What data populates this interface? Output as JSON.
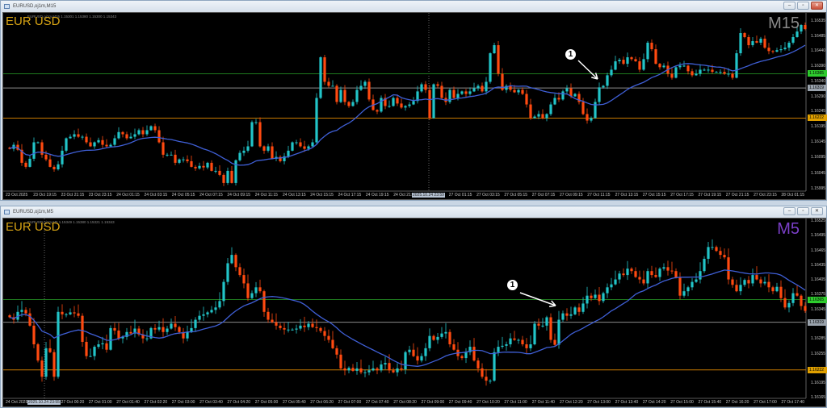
{
  "colors": {
    "bull": "#22c4c8",
    "bear": "#ff4a10",
    "ma": "#3f5fd6",
    "green_line": "#1f7a1f",
    "gray_line": "#8a8a8a",
    "orange_line": "#c87a00",
    "symbol": "#d9a514",
    "m15": "#8a8a8a",
    "m5": "#7b3fc8"
  },
  "windows": [
    {
      "title": "EURUSD,oj1m,M15",
      "symbol_label": "EUR USD",
      "ohlc_text": "EURUSD,oj1m,M15 1.15301 1.15380 1.15300 1.15343",
      "timeframe_label": "M15",
      "annotation": "1",
      "buttons": {
        "minimize": "–",
        "maximize": "▫",
        "close": "✕"
      },
      "price_badges": [
        {
          "value": "1.16365",
          "color": "#2ecc2e"
        },
        {
          "value": "1.16319",
          "color": "#9aa3ad"
        },
        {
          "value": "1.16222",
          "color": "#e0a000"
        }
      ],
      "time_highlight": "2025.10.24 23:59",
      "time_labels": [
        "23 Oct 2025",
        "23 Oct 19:15",
        "23 Oct 21:15",
        "23 Oct 23:15",
        "24 Oct 01:15",
        "24 Oct 03:15",
        "24 Oct 05:15",
        "24 Oct 07:15",
        "24 Oct 09:15",
        "24 Oct 11:15",
        "24 Oct 13:15",
        "24 Oct 15:15",
        "24 Oct 17:15",
        "24 Oct 19:15",
        "24 Oct 21:15",
        "",
        "27 Oct 01:15",
        "27 Oct 03:15",
        "27 Oct 05:15",
        "27 Oct 07:15",
        "27 Oct 09:15",
        "27 Oct 11:15",
        "27 Oct 13:15",
        "27 Oct 15:15",
        "27 Oct 17:15",
        "27 Oct 19:15",
        "27 Oct 21:15",
        "27 Oct 23:15",
        "28 Oct 01:15"
      ]
    },
    {
      "title": "EURUSD,oj1m,M5",
      "symbol_label": "EUR USD",
      "ohlc_text": "EURUSD,oj1m,M5 1.15349 1.15380 1.15321 1.15343",
      "timeframe_label": "M5",
      "annotation": "1",
      "buttons": {
        "minimize": "–",
        "maximize": "▫",
        "close": "✕"
      },
      "price_badges": [
        {
          "value": "1.16365",
          "color": "#2ecc2e"
        },
        {
          "value": "1.16319",
          "color": "#9aa3ad"
        },
        {
          "value": "1.16222",
          "color": "#e0a000"
        }
      ],
      "time_highlight": "2025.10.24 23:55",
      "time_labels": [
        "24 Oct 2025",
        "",
        "27 Oct 00:20",
        "27 Oct 01:00",
        "27 Oct 01:40",
        "27 Oct 02:20",
        "27 Oct 03:00",
        "27 Oct 03:40",
        "27 Oct 04:20",
        "27 Oct 05:00",
        "27 Oct 05:40",
        "27 Oct 06:20",
        "27 Oct 07:00",
        "27 Oct 07:40",
        "27 Oct 08:20",
        "27 Oct 09:00",
        "27 Oct 09:40",
        "27 Oct 10:20",
        "27 Oct 11:00",
        "27 Oct 11:40",
        "27 Oct 12:20",
        "27 Oct 13:00",
        "27 Oct 13:40",
        "27 Oct 14:20",
        "27 Oct 15:00",
        "27 Oct 15:40",
        "27 Oct 16:20",
        "27 Oct 17:00",
        "27 Oct 17:40"
      ]
    }
  ],
  "chart_data": [
    {
      "type": "candlestick",
      "title": "EURUSD M15",
      "ylim": [
        1.15992,
        1.16561
      ],
      "yticks": [
        "1.16535",
        "1.16485",
        "1.16440",
        "1.16390",
        "1.16340",
        "1.16290",
        "1.16245",
        "1.16195",
        "1.16145",
        "1.16095",
        "1.16045",
        "1.15995"
      ],
      "hlines": [
        1.16365,
        1.16319,
        1.16222
      ],
      "ma_period": 20,
      "closes": [
        1.16123,
        1.16136,
        1.1612,
        1.16078,
        1.16065,
        1.16091,
        1.16144,
        1.16144,
        1.16104,
        1.16089,
        1.16065,
        1.16057,
        1.16073,
        1.16117,
        1.16157,
        1.16162,
        1.1617,
        1.16162,
        1.16162,
        1.16144,
        1.16131,
        1.16144,
        1.16151,
        1.16136,
        1.16131,
        1.16136,
        1.16157,
        1.16177,
        1.1617,
        1.16157,
        1.16162,
        1.1617,
        1.16183,
        1.1617,
        1.16183,
        1.16196,
        1.16183,
        1.16144,
        1.16104,
        1.16104,
        1.16104,
        1.16078,
        1.16089,
        1.16089,
        1.16083,
        1.16065,
        1.1606,
        1.16068,
        1.16063,
        1.16078,
        1.16052,
        1.16052,
        1.16039,
        1.16013,
        1.16052,
        1.16013,
        1.16086,
        1.1611,
        1.16117,
        1.16131,
        1.16209,
        1.16209,
        1.16131,
        1.16117,
        1.16131,
        1.16091,
        1.16097,
        1.16083,
        1.16099,
        1.16117,
        1.16144,
        1.16144,
        1.16131,
        1.16123,
        1.16131,
        1.16144,
        1.16287,
        1.16418,
        1.16339,
        1.16326,
        1.16326,
        1.16274,
        1.16313,
        1.16274,
        1.16261,
        1.16274,
        1.16313,
        1.16326,
        1.16339,
        1.16282,
        1.16248,
        1.16243,
        1.16287,
        1.16261,
        1.16261,
        1.16287,
        1.16269,
        1.16256,
        1.16261,
        1.16266,
        1.16277,
        1.16308,
        1.16331,
        1.16313,
        1.16222,
        1.16331,
        1.16326,
        1.16287,
        1.16274,
        1.16313,
        1.16287,
        1.163,
        1.16308,
        1.163,
        1.16308,
        1.16318,
        1.16326,
        1.16308,
        1.16339,
        1.16431,
        1.16457,
        1.16365,
        1.16313,
        1.16326,
        1.16313,
        1.16305,
        1.16313,
        1.163,
        1.16266,
        1.16222,
        1.16227,
        1.16235,
        1.16222,
        1.16235,
        1.16266,
        1.16287,
        1.16282,
        1.16308,
        1.16318,
        1.16292,
        1.163,
        1.16274,
        1.16235,
        1.16214,
        1.16222,
        1.16274,
        1.16321,
        1.16326,
        1.1636,
        1.16378,
        1.16405,
        1.1641,
        1.16397,
        1.16418,
        1.16412,
        1.16405,
        1.16378,
        1.16412,
        1.16465,
        1.16444,
        1.16397,
        1.16386,
        1.16391,
        1.16365,
        1.16352,
        1.16386,
        1.16391,
        1.16391,
        1.16373,
        1.1636,
        1.16365,
        1.16378,
        1.16378,
        1.16378,
        1.16371,
        1.16371,
        1.16371,
        1.16365,
        1.16365,
        1.16352,
        1.16431,
        1.16496,
        1.16483,
        1.16457,
        1.1647,
        1.16465,
        1.16478,
        1.16449,
        1.16438,
        1.16436,
        1.16441,
        1.16444,
        1.16449,
        1.16465,
        1.16483,
        1.16501,
        1.16522,
        1.16509
      ]
    },
    {
      "type": "candlestick",
      "title": "EURUSD M5",
      "ylim": [
        1.16169,
        1.1653
      ],
      "yticks": [
        "1.16525",
        "1.16495",
        "1.16465",
        "1.16435",
        "1.16405",
        "1.16375",
        "1.16345",
        "1.16285",
        "1.16255",
        "1.16195",
        "1.16165"
      ],
      "hlines": [
        1.16365,
        1.16319,
        1.16222
      ],
      "ma_period": 20,
      "closes": [
        1.16329,
        1.16324,
        1.1634,
        1.16344,
        1.16337,
        1.16312,
        1.16274,
        1.16241,
        1.16208,
        1.16266,
        1.16258,
        1.16208,
        1.1634,
        1.16335,
        1.16335,
        1.16339,
        1.16337,
        1.16332,
        1.16279,
        1.1625,
        1.1625,
        1.16269,
        1.16274,
        1.16276,
        1.16263,
        1.16307,
        1.16302,
        1.16286,
        1.16289,
        1.16299,
        1.16296,
        1.16306,
        1.16294,
        1.16286,
        1.16286,
        1.16307,
        1.16304,
        1.16309,
        1.16299,
        1.16306,
        1.16316,
        1.16309,
        1.16299,
        1.16286,
        1.16299,
        1.16307,
        1.16324,
        1.16332,
        1.16335,
        1.16339,
        1.16344,
        1.16349,
        1.16362,
        1.16401,
        1.16439,
        1.16456,
        1.16431,
        1.16415,
        1.16398,
        1.16368,
        1.16378,
        1.1639,
        1.16382,
        1.1634,
        1.16324,
        1.16319,
        1.16312,
        1.16307,
        1.16304,
        1.16304,
        1.16304,
        1.16306,
        1.16312,
        1.16309,
        1.16316,
        1.16309,
        1.16307,
        1.16301,
        1.16291,
        1.16283,
        1.16266,
        1.16253,
        1.16225,
        1.16221,
        1.16226,
        1.1622,
        1.16225,
        1.16217,
        1.16217,
        1.16221,
        1.16225,
        1.16221,
        1.16233,
        1.16236,
        1.16221,
        1.16217,
        1.16225,
        1.16223,
        1.16258,
        1.16263,
        1.1625,
        1.16241,
        1.1625,
        1.16266,
        1.16291,
        1.16283,
        1.16289,
        1.16296,
        1.16299,
        1.16274,
        1.16263,
        1.1625,
        1.16246,
        1.16258,
        1.16269,
        1.16241,
        1.16225,
        1.16208,
        1.162,
        1.162,
        1.16258,
        1.16269,
        1.16271,
        1.16274,
        1.16286,
        1.16283,
        1.16283,
        1.16274,
        1.16266,
        1.16274,
        1.16316,
        1.16312,
        1.16312,
        1.16329,
        1.16283,
        1.16273,
        1.16324,
        1.16337,
        1.16332,
        1.16335,
        1.16349,
        1.1634,
        1.16357,
        1.16373,
        1.16368,
        1.16375,
        1.16362,
        1.16378,
        1.1639,
        1.16396,
        1.16406,
        1.16418,
        1.16415,
        1.16428,
        1.16423,
        1.16411,
        1.16406,
        1.16398,
        1.16423,
        1.16415,
        1.16411,
        1.16428,
        1.16431,
        1.16424,
        1.16423,
        1.1641,
        1.16373,
        1.16382,
        1.1639,
        1.16401,
        1.16406,
        1.16423,
        1.16448,
        1.16472,
        1.16472,
        1.16464,
        1.16456,
        1.16451,
        1.16406,
        1.16395,
        1.16382,
        1.16395,
        1.16405,
        1.16398,
        1.16415,
        1.16406,
        1.16398,
        1.16401,
        1.1639,
        1.16382,
        1.16391,
        1.16368,
        1.16349,
        1.16358,
        1.16378,
        1.16373,
        1.16352,
        1.16342
      ]
    }
  ]
}
